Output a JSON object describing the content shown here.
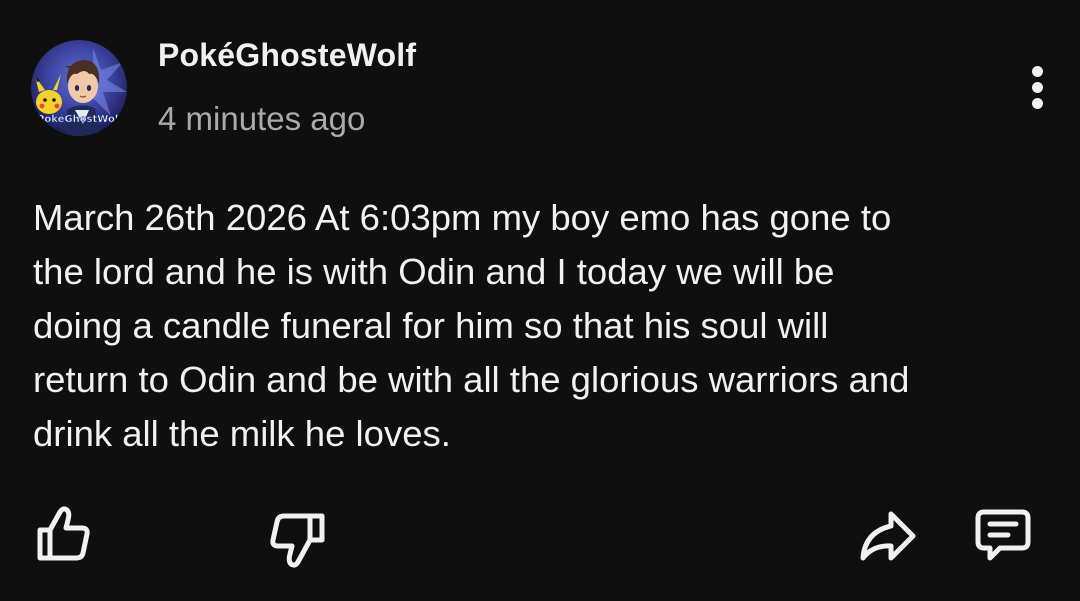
{
  "post": {
    "author": {
      "name": "PokéGhosteWolf",
      "avatar_text": "PokéGhostWolf"
    },
    "time": "4 minutes ago",
    "body": "March 26th 2026 At 6:03pm my boy emo has gone to\nthe lord and he is with Odin and I today we will be\ndoing a candle funeral for him so that his soul will\nreturn to Odin and be with all the glorious warriors and\ndrink all the milk he loves."
  },
  "actions": {
    "like_icon": "thumbs-up-icon",
    "dislike_icon": "thumbs-down-icon",
    "share_icon": "share-icon",
    "comment_icon": "comment-icon"
  },
  "colors": {
    "background": "#0f0f0f",
    "text_primary": "#f1f1f1",
    "text_secondary": "#aaaaaa"
  }
}
